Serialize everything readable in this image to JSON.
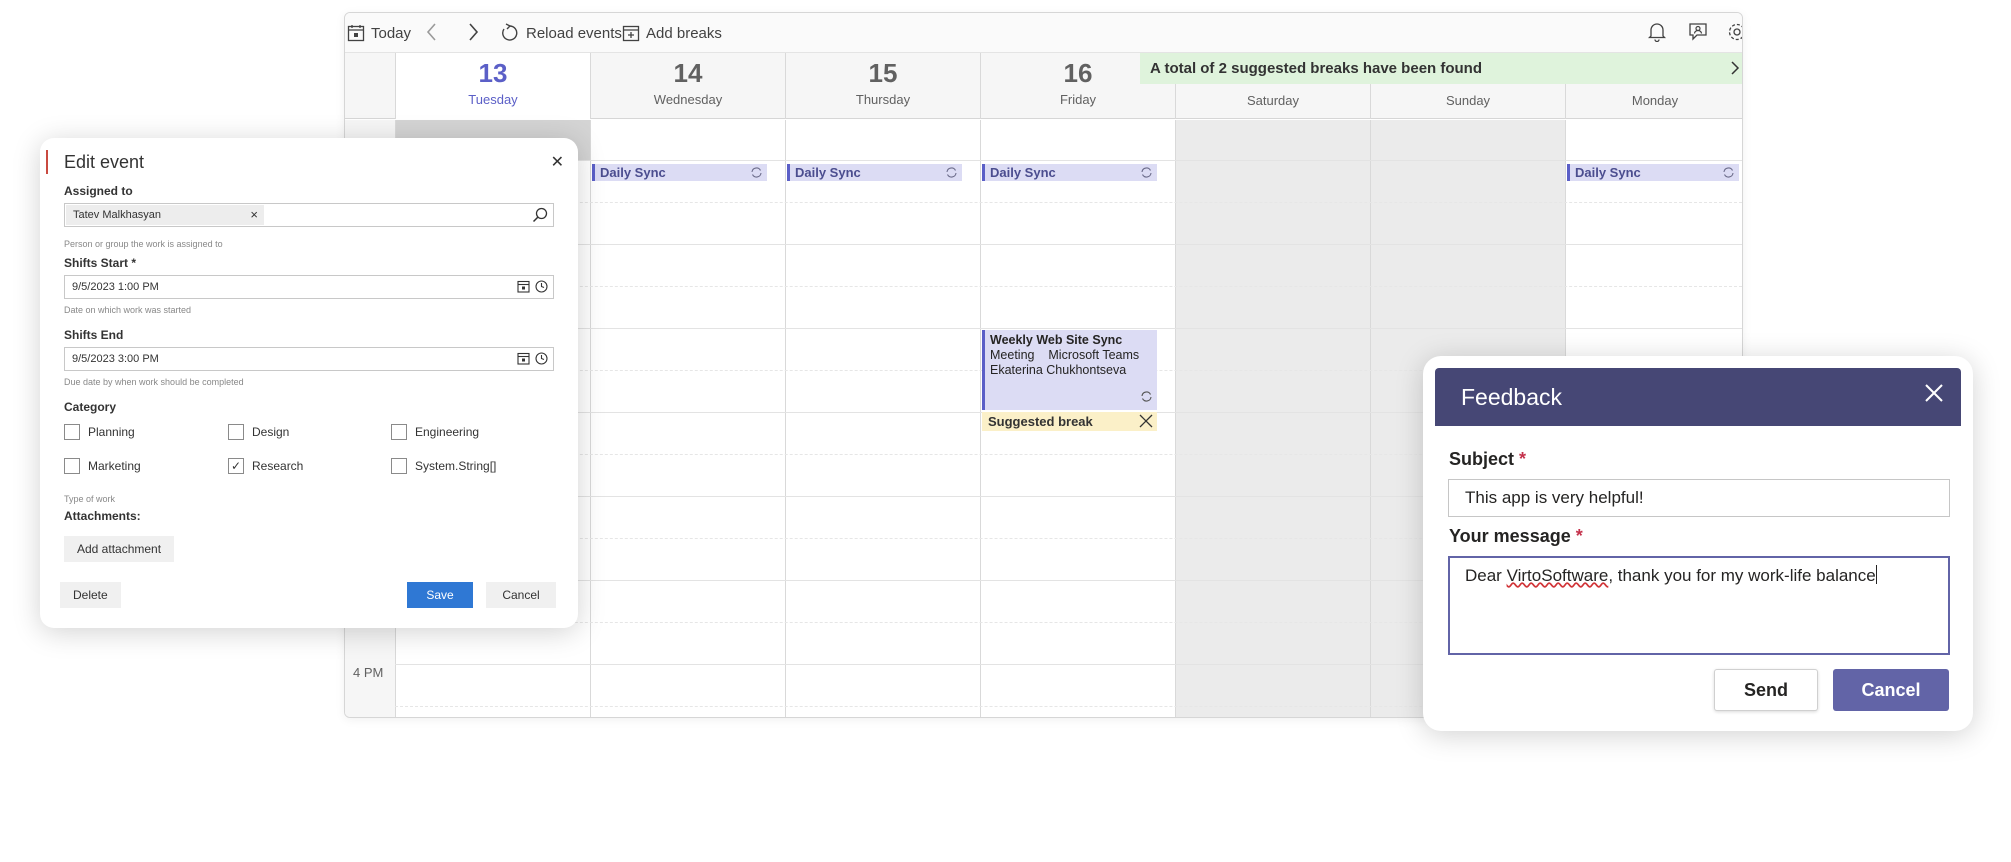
{
  "toolbar": {
    "today": "Today",
    "reload": "Reload events",
    "add_breaks": "Add breaks"
  },
  "days": [
    {
      "num": "13",
      "name": "Tuesday"
    },
    {
      "num": "14",
      "name": "Wednesday"
    },
    {
      "num": "15",
      "name": "Thursday"
    },
    {
      "num": "16",
      "name": "Friday"
    },
    {
      "num": "",
      "name": "Saturday"
    },
    {
      "num": "",
      "name": "Sunday"
    },
    {
      "num": "",
      "name": "Monday"
    }
  ],
  "banner": {
    "text": "A total of 2 suggested breaks have been found"
  },
  "time_labels": {
    "t4pm": "4 PM"
  },
  "events": {
    "daily_sync": "Daily Sync",
    "weekly": {
      "title": "Weekly Web Site Sync",
      "type": "Meeting",
      "location": "Microsoft Teams",
      "person": "Ekaterina Chukhontseva"
    },
    "suggested_break": "Suggested break"
  },
  "edit_event": {
    "title": "Edit event",
    "assigned_label": "Assigned to",
    "assigned_value": "Tatev Malkhasyan",
    "assigned_hint": "Person or group the work is assigned to",
    "start_label": "Shifts Start *",
    "start_value": "9/5/2023 1:00 PM",
    "start_hint": "Date on which work was started",
    "end_label": "Shifts End",
    "end_value": "9/5/2023 3:00 PM",
    "end_hint": "Due date by when work should be completed",
    "category_label": "Category",
    "categories": [
      {
        "label": "Planning",
        "checked": false
      },
      {
        "label": "Design",
        "checked": false
      },
      {
        "label": "Engineering",
        "checked": false
      },
      {
        "label": "Marketing",
        "checked": false
      },
      {
        "label": "Research",
        "checked": true
      },
      {
        "label": "System.String[]",
        "checked": false
      }
    ],
    "category_hint": "Type of work",
    "attachments_label": "Attachments:",
    "add_attachment": "Add attachment",
    "delete": "Delete",
    "save": "Save",
    "cancel": "Cancel"
  },
  "feedback": {
    "title": "Feedback",
    "subject_label": "Subject",
    "subject_value": "This app is very helpful!",
    "message_label": "Your message",
    "message_pre": "Dear ",
    "message_spell": "VirtoSoftware",
    "message_post": ", thank you for my work-life balance",
    "required": "*",
    "send": "Send",
    "cancel": "Cancel"
  },
  "colors": {
    "accent": "#5b5fc7",
    "teams_header": "#464775",
    "teams_button": "#6264a7",
    "save_button": "#2f78d4",
    "banner_bg": "#dff3dc",
    "suggested_bg": "#fbf0c8"
  },
  "icons": [
    "calendar-today-icon",
    "chevron-left-icon",
    "chevron-right-icon",
    "reload-icon",
    "add-breaks-icon",
    "bell-icon",
    "feedback-icon",
    "gear-icon",
    "sync-icon",
    "close-icon",
    "search-icon",
    "calendar-icon",
    "clock-icon",
    "check-icon"
  ]
}
